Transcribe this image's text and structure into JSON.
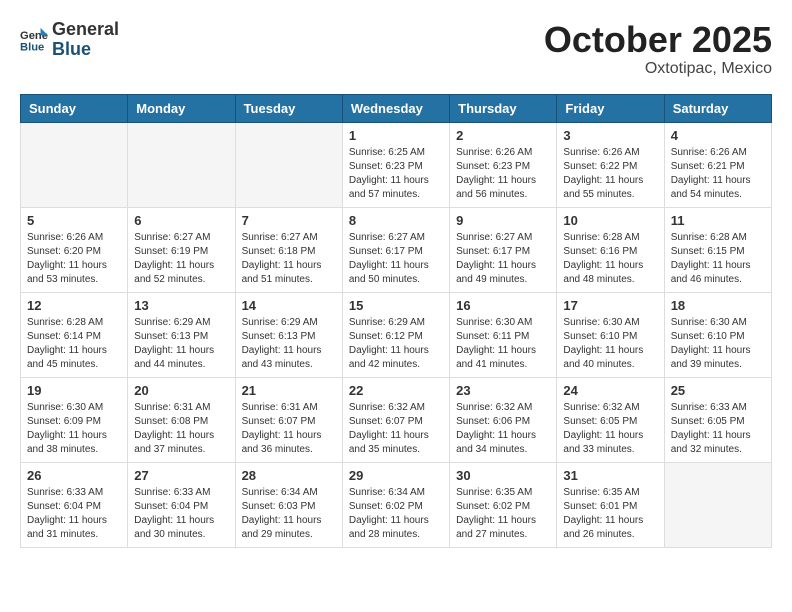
{
  "header": {
    "logo_general": "General",
    "logo_blue": "Blue",
    "month": "October 2025",
    "location": "Oxtotipac, Mexico"
  },
  "weekdays": [
    "Sunday",
    "Monday",
    "Tuesday",
    "Wednesday",
    "Thursday",
    "Friday",
    "Saturday"
  ],
  "weeks": [
    [
      {
        "day": "",
        "info": ""
      },
      {
        "day": "",
        "info": ""
      },
      {
        "day": "",
        "info": ""
      },
      {
        "day": "1",
        "info": "Sunrise: 6:25 AM\nSunset: 6:23 PM\nDaylight: 11 hours and 57 minutes."
      },
      {
        "day": "2",
        "info": "Sunrise: 6:26 AM\nSunset: 6:23 PM\nDaylight: 11 hours and 56 minutes."
      },
      {
        "day": "3",
        "info": "Sunrise: 6:26 AM\nSunset: 6:22 PM\nDaylight: 11 hours and 55 minutes."
      },
      {
        "day": "4",
        "info": "Sunrise: 6:26 AM\nSunset: 6:21 PM\nDaylight: 11 hours and 54 minutes."
      }
    ],
    [
      {
        "day": "5",
        "info": "Sunrise: 6:26 AM\nSunset: 6:20 PM\nDaylight: 11 hours and 53 minutes."
      },
      {
        "day": "6",
        "info": "Sunrise: 6:27 AM\nSunset: 6:19 PM\nDaylight: 11 hours and 52 minutes."
      },
      {
        "day": "7",
        "info": "Sunrise: 6:27 AM\nSunset: 6:18 PM\nDaylight: 11 hours and 51 minutes."
      },
      {
        "day": "8",
        "info": "Sunrise: 6:27 AM\nSunset: 6:17 PM\nDaylight: 11 hours and 50 minutes."
      },
      {
        "day": "9",
        "info": "Sunrise: 6:27 AM\nSunset: 6:17 PM\nDaylight: 11 hours and 49 minutes."
      },
      {
        "day": "10",
        "info": "Sunrise: 6:28 AM\nSunset: 6:16 PM\nDaylight: 11 hours and 48 minutes."
      },
      {
        "day": "11",
        "info": "Sunrise: 6:28 AM\nSunset: 6:15 PM\nDaylight: 11 hours and 46 minutes."
      }
    ],
    [
      {
        "day": "12",
        "info": "Sunrise: 6:28 AM\nSunset: 6:14 PM\nDaylight: 11 hours and 45 minutes."
      },
      {
        "day": "13",
        "info": "Sunrise: 6:29 AM\nSunset: 6:13 PM\nDaylight: 11 hours and 44 minutes."
      },
      {
        "day": "14",
        "info": "Sunrise: 6:29 AM\nSunset: 6:13 PM\nDaylight: 11 hours and 43 minutes."
      },
      {
        "day": "15",
        "info": "Sunrise: 6:29 AM\nSunset: 6:12 PM\nDaylight: 11 hours and 42 minutes."
      },
      {
        "day": "16",
        "info": "Sunrise: 6:30 AM\nSunset: 6:11 PM\nDaylight: 11 hours and 41 minutes."
      },
      {
        "day": "17",
        "info": "Sunrise: 6:30 AM\nSunset: 6:10 PM\nDaylight: 11 hours and 40 minutes."
      },
      {
        "day": "18",
        "info": "Sunrise: 6:30 AM\nSunset: 6:10 PM\nDaylight: 11 hours and 39 minutes."
      }
    ],
    [
      {
        "day": "19",
        "info": "Sunrise: 6:30 AM\nSunset: 6:09 PM\nDaylight: 11 hours and 38 minutes."
      },
      {
        "day": "20",
        "info": "Sunrise: 6:31 AM\nSunset: 6:08 PM\nDaylight: 11 hours and 37 minutes."
      },
      {
        "day": "21",
        "info": "Sunrise: 6:31 AM\nSunset: 6:07 PM\nDaylight: 11 hours and 36 minutes."
      },
      {
        "day": "22",
        "info": "Sunrise: 6:32 AM\nSunset: 6:07 PM\nDaylight: 11 hours and 35 minutes."
      },
      {
        "day": "23",
        "info": "Sunrise: 6:32 AM\nSunset: 6:06 PM\nDaylight: 11 hours and 34 minutes."
      },
      {
        "day": "24",
        "info": "Sunrise: 6:32 AM\nSunset: 6:05 PM\nDaylight: 11 hours and 33 minutes."
      },
      {
        "day": "25",
        "info": "Sunrise: 6:33 AM\nSunset: 6:05 PM\nDaylight: 11 hours and 32 minutes."
      }
    ],
    [
      {
        "day": "26",
        "info": "Sunrise: 6:33 AM\nSunset: 6:04 PM\nDaylight: 11 hours and 31 minutes."
      },
      {
        "day": "27",
        "info": "Sunrise: 6:33 AM\nSunset: 6:04 PM\nDaylight: 11 hours and 30 minutes."
      },
      {
        "day": "28",
        "info": "Sunrise: 6:34 AM\nSunset: 6:03 PM\nDaylight: 11 hours and 29 minutes."
      },
      {
        "day": "29",
        "info": "Sunrise: 6:34 AM\nSunset: 6:02 PM\nDaylight: 11 hours and 28 minutes."
      },
      {
        "day": "30",
        "info": "Sunrise: 6:35 AM\nSunset: 6:02 PM\nDaylight: 11 hours and 27 minutes."
      },
      {
        "day": "31",
        "info": "Sunrise: 6:35 AM\nSunset: 6:01 PM\nDaylight: 11 hours and 26 minutes."
      },
      {
        "day": "",
        "info": ""
      }
    ]
  ]
}
